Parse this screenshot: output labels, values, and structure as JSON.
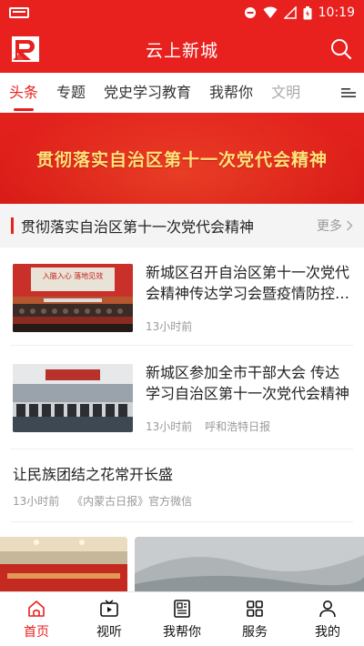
{
  "status_bar": {
    "time": "10:19"
  },
  "app": {
    "title": "云上新城"
  },
  "tabs": [
    {
      "label": "头条",
      "active": true
    },
    {
      "label": "专题"
    },
    {
      "label": "党史学习教育"
    },
    {
      "label": "我帮你"
    },
    {
      "label": "文明"
    }
  ],
  "banner": {
    "text": "贯彻落实自治区第十一次党代会精神"
  },
  "section": {
    "title": "贯彻落实自治区第十一次党代会精神",
    "more_label": "更多"
  },
  "news": [
    {
      "headline": "新城区召开自治区第十一次党代会精神传达学习会暨疫情防控工作会议",
      "time": "13小时前",
      "source": "",
      "thumb_banner": "入脑入心 落地见效"
    },
    {
      "headline": "新城区参加全市干部大会 传达学习自治区第十一次党代会精神",
      "time": "13小时前",
      "source": "呼和浩特日报"
    }
  ],
  "text_news": {
    "headline": "让民族团结之花常开长盛",
    "time": "13小时前",
    "source": "《内蒙古日报》官方微信"
  },
  "bottom_nav": [
    {
      "label": "首页",
      "icon": "home-icon",
      "active": true
    },
    {
      "label": "视听",
      "icon": "tv-icon"
    },
    {
      "label": "我帮你",
      "icon": "news-icon"
    },
    {
      "label": "服务",
      "icon": "grid-icon"
    },
    {
      "label": "我的",
      "icon": "user-icon"
    }
  ],
  "colors": {
    "brand": "#e8201e",
    "banner_text": "#ffe27a"
  }
}
